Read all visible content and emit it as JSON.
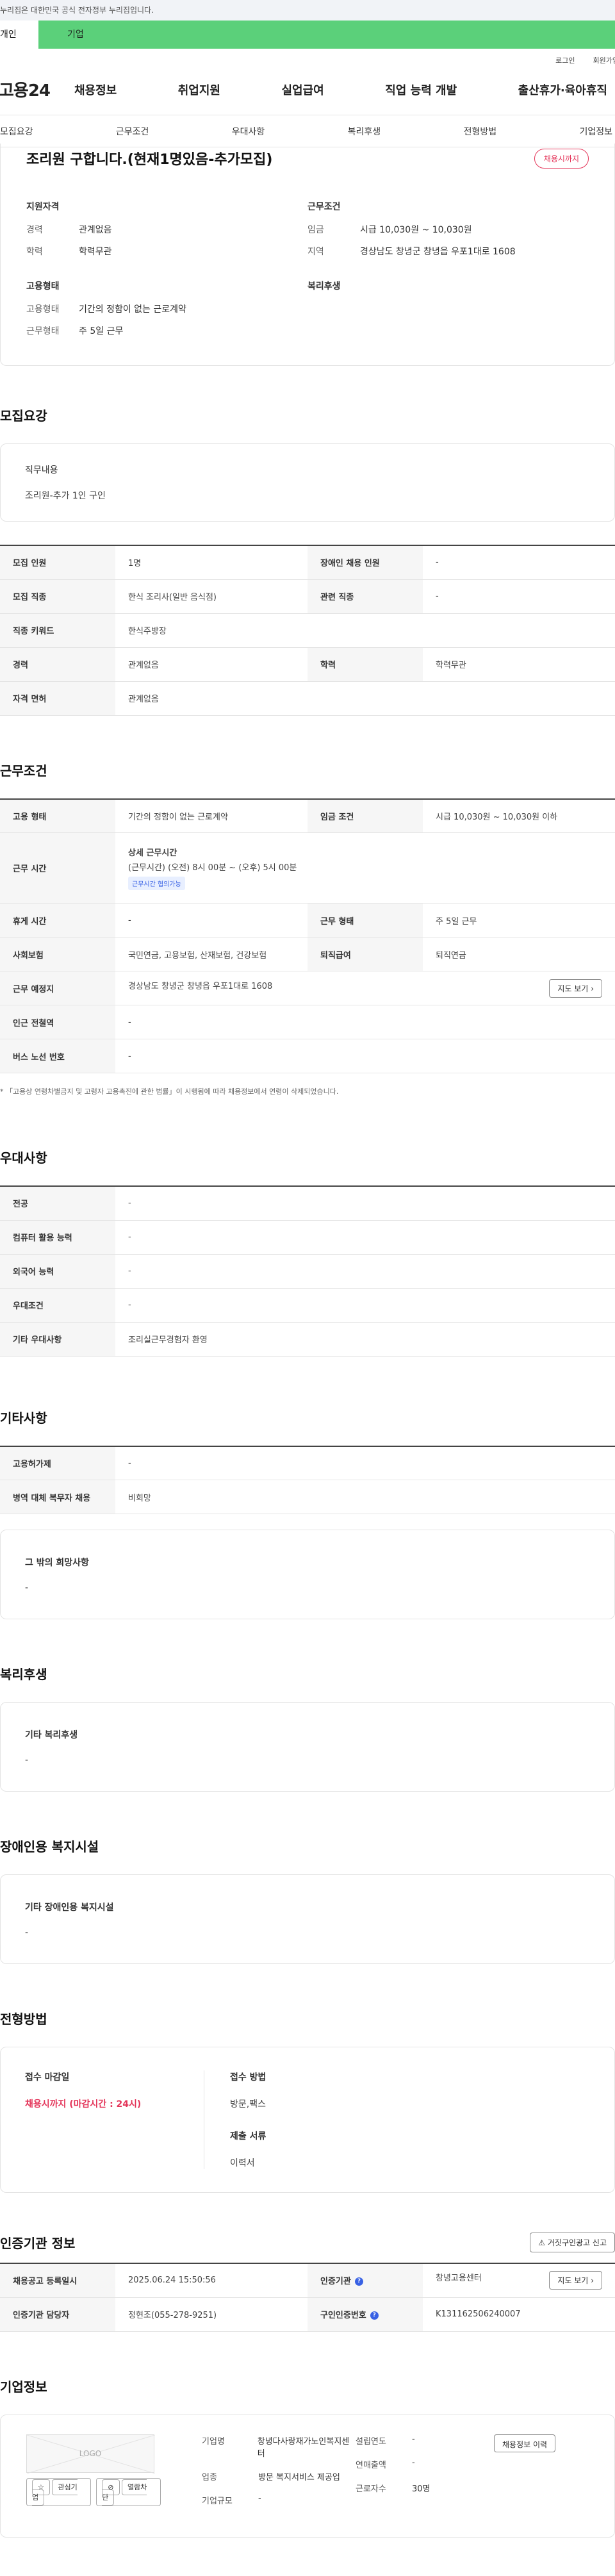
{
  "gov_banner": "누리집은 대한민국 공식 전자정부 누리집입니다.",
  "site_tabs": {
    "personal": "개인",
    "company": "기업"
  },
  "util": {
    "login": "로그인",
    "join": "회원가입"
  },
  "logo": "고용24",
  "gnb": [
    "채용정보",
    "취업지원",
    "실업급여",
    "직업 능력 개발",
    "출산휴가·육아휴직"
  ],
  "sub_tabs": [
    "모집요강",
    "근무조건",
    "우대사항",
    "복리후생",
    "전형방법",
    "기업정보"
  ],
  "summary": {
    "title": "조리원 구합니다.(현재1명있음-추가모집)",
    "status": "채용시까지",
    "qualification_head": "지원자격",
    "career_label": "경력",
    "career": "관계없음",
    "education_label": "학력",
    "education": "학력무관",
    "employment_head": "고용형태",
    "emp_type_label": "고용형태",
    "emp_type": "기간의 정함이 없는 근로계약",
    "work_type_label": "근무형태",
    "work_type": "주 5일 근무",
    "conditions_head": "근무조건",
    "wage_label": "임금",
    "wage": "시급 10,030원 ~ 10,030원",
    "region_label": "지역",
    "region": "경상남도 창녕군 창녕읍 우포1대로 1608",
    "welfare_head": "복리후생"
  },
  "recruit": {
    "title": "모집요강",
    "job_label": "직무내용",
    "job_value": "조리원-추가 1인 구인",
    "rows": [
      {
        "k1": "모집 인원",
        "v1": "1명",
        "k2": "장애인 채용 인원",
        "v2": "-"
      },
      {
        "k1": "모집 직종",
        "v1": "한식 조리사(일반 음식점)",
        "k2": "관련 직종",
        "v2": "-"
      },
      {
        "k1": "직종 키워드",
        "v1": "한식주방장"
      },
      {
        "k1": "경력",
        "v1": "관계없음",
        "k2": "학력",
        "v2": "학력무관"
      },
      {
        "k1": "자격 면허",
        "v1": "관계없음"
      }
    ]
  },
  "conditions": {
    "title": "근무조건",
    "emp_type_k": "고용 형태",
    "emp_type_v": "기간의 정함이 없는 근로계약",
    "wage_k": "임금 조건",
    "wage_v": "시급 10,030원 ~ 10,030원 이하",
    "hours_k": "근무 시간",
    "hours_head": "상세 근무시간",
    "hours_v": "(근무시간) (오전) 8시 00분 ~ (오후) 5시 00분",
    "hours_badge": "근무시간 협의가능",
    "rest_k": "휴게 시간",
    "rest_v": "-",
    "form_k": "근무 형태",
    "form_v": "주 5일 근무",
    "ins_k": "사회보험",
    "ins_v": "국민연금, 고용보험, 산재보험, 건강보험",
    "ret_k": "퇴직급여",
    "ret_v": "퇴직연금",
    "place_k": "근무 예정지",
    "place_v": "경상남도 창녕군 창녕읍 우포1대로 1608",
    "map_btn": "지도 보기",
    "subway_k": "인근 전철역",
    "subway_v": "-",
    "bus_k": "버스 노선 번호",
    "bus_v": "-",
    "note": "* 「고용상 연령차별금지 및 고령자 고용촉진에 관한 법률」이 시행됨에 따라 채용정보에서 연령이 삭제되었습니다."
  },
  "preference": {
    "title": "우대사항",
    "rows": [
      {
        "k": "전공",
        "v": "-"
      },
      {
        "k": "컴퓨터 활용 능력",
        "v": "-"
      },
      {
        "k": "외국어 능력",
        "v": "-"
      },
      {
        "k": "우대조건",
        "v": "-"
      },
      {
        "k": "기타 우대사항",
        "v": "조리실근무경험자 환영"
      }
    ]
  },
  "etc": {
    "title": "기타사항",
    "rows": [
      {
        "k": "고용허가제",
        "v": "-"
      },
      {
        "k": "병역 대체 복무자 채용",
        "v": "비희망"
      }
    ],
    "box_label": "그 밖의 희망사항",
    "box_value": "-"
  },
  "welfare": {
    "title": "복리후생",
    "box_label": "기타 복리후생",
    "box_value": "-"
  },
  "disabled": {
    "title": "장애인용 복지시설",
    "box_label": "기타 장애인용 복지시설",
    "box_value": "-"
  },
  "process": {
    "title": "전형방법",
    "deadline_label": "접수 마감일",
    "deadline_value": "채용시까지 (마감시간 : 24시)",
    "method_label": "접수 방법",
    "method_value": "방문,팩스",
    "docs_label": "제출 서류",
    "docs_value": "이력서"
  },
  "cert": {
    "title": "인증기관 정보",
    "report_btn": "거짓구인광고 신고",
    "reg_k": "채용공고 등록일시",
    "reg_v": "2025.06.24 15:50:56",
    "org_k": "인증기관",
    "org_v": "창녕고용센터",
    "map_btn": "지도 보기",
    "manager_k": "인증기관 담당자",
    "manager_v": "정현조(055-278-9251)",
    "cert_no_k": "구인인증번호",
    "cert_no_v": "K131162506240007"
  },
  "company": {
    "title": "기업정보",
    "logo_placeholder": "LOGO",
    "interest_btn": "관심기업",
    "block_btn": "열람차단",
    "name_k": "기업명",
    "name_v": "창녕다사랑재가노인복지센터",
    "industry_k": "업종",
    "industry_v": "방문 복지서비스 제공업",
    "size_k": "기업규모",
    "size_v": "-",
    "founded_k": "설립연도",
    "founded_v": "-",
    "sales_k": "연매출액",
    "sales_v": "-",
    "staff_k": "근로자수",
    "staff_v": "30명",
    "history_btn": "채용정보 이력"
  }
}
